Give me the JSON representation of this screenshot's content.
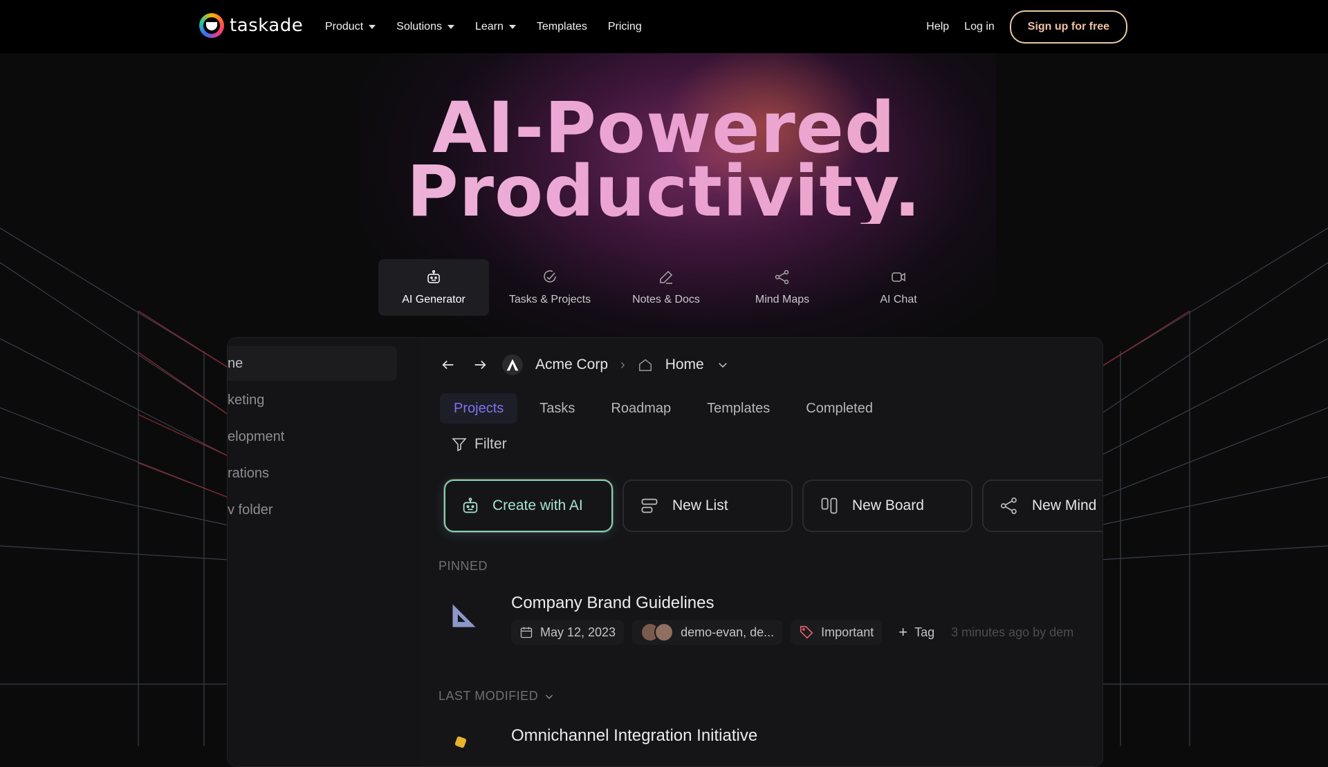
{
  "nav": {
    "brand": "taskade",
    "links": [
      "Product",
      "Solutions",
      "Learn",
      "Templates",
      "Pricing"
    ],
    "help": "Help",
    "login": "Log in",
    "signup": "Sign up for free"
  },
  "hero": {
    "line1": "AI-Powered",
    "line2": "Productivity."
  },
  "feature_tabs": [
    {
      "label": "AI Generator",
      "icon": "robot-icon",
      "active": true
    },
    {
      "label": "Tasks & Projects",
      "icon": "check-circle-icon"
    },
    {
      "label": "Notes & Docs",
      "icon": "pencil-icon"
    },
    {
      "label": "Mind Maps",
      "icon": "share-nodes-icon"
    },
    {
      "label": "AI Chat",
      "icon": "video-icon"
    }
  ],
  "app": {
    "sidebar": [
      "ne",
      "keting",
      "elopment",
      "rations",
      "v folder"
    ],
    "breadcrumb": {
      "workspace": "Acme Corp",
      "folder": "Home"
    },
    "tabs": [
      "Projects",
      "Tasks",
      "Roadmap",
      "Templates",
      "Completed"
    ],
    "filter": "Filter",
    "actions": [
      "Create with AI",
      "New List",
      "New Board",
      "New Mind"
    ],
    "pinned_label": "PINNED",
    "pinned_item": {
      "title": "Company Brand Guidelines",
      "date": "May 12, 2023",
      "members": "demo-evan, de...",
      "tag": "Important",
      "add_tag": "Tag",
      "updated": "3 minutes ago by dem"
    },
    "last_modified_label": "LAST MODIFIED",
    "next_item_title": "Omnichannel Integration Initiative"
  },
  "colors": {
    "accent_purple": "#7f72f0",
    "ai_button": "#a8e4cd",
    "hero_pink": "#eaa0d1"
  }
}
